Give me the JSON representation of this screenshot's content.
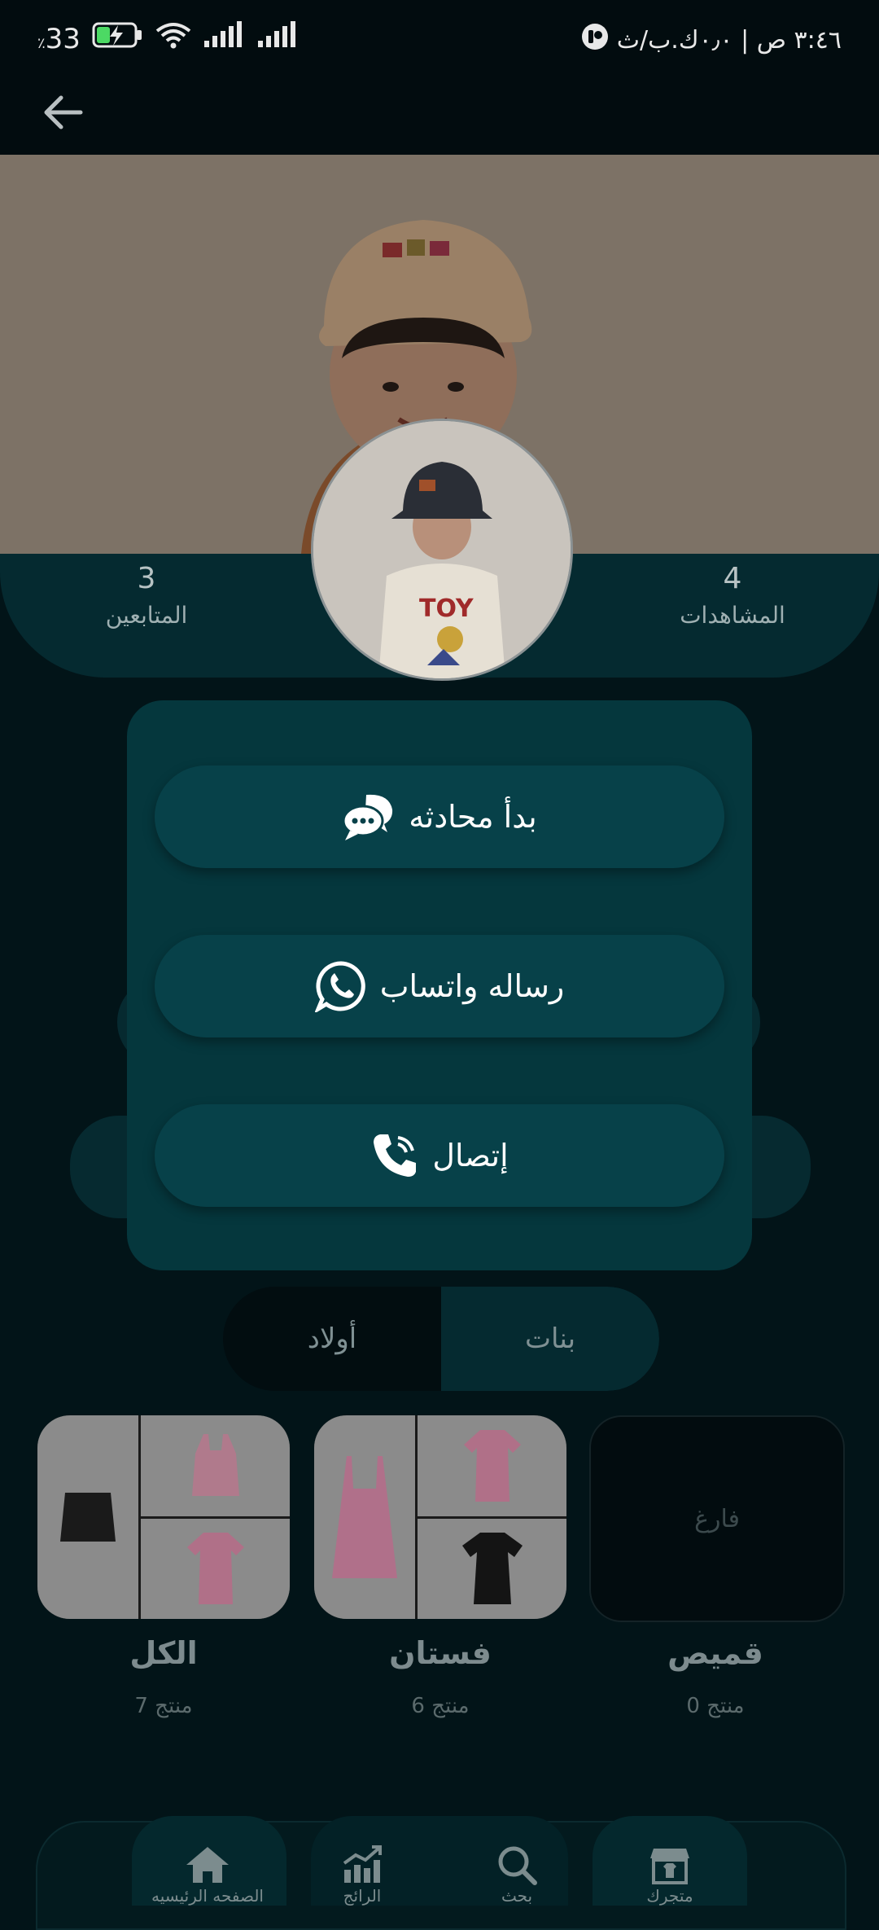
{
  "status_bar": {
    "time": "٣:٤٦ ص | ٠٫٠ك.ب/ث",
    "battery": "33",
    "battery_suffix": "٪"
  },
  "profile": {
    "views_count": "4",
    "views_label": "المشاهدات",
    "followers_count": "3",
    "followers_label": "المتابعين"
  },
  "modal": {
    "start_chat_label": "بدأ محادثه",
    "whatsapp_label": "رساله واتساب",
    "call_label": "إتصال"
  },
  "tabs": {
    "girls": "بنات",
    "boys": "أولاد",
    "active": "girls"
  },
  "categories": [
    {
      "title": "قميص",
      "count": "0 منتج",
      "empty_label": "فارغ"
    },
    {
      "title": "فستان",
      "count": "6 منتج"
    },
    {
      "title": "الكل",
      "count": "7 منتج"
    }
  ],
  "bottom_nav": [
    {
      "label": "متجرك",
      "icon": "store-icon"
    },
    {
      "label": "بحث",
      "icon": "search-icon"
    },
    {
      "label": "الرائج",
      "icon": "trending-chart-icon"
    },
    {
      "label": "الصفحه الرئيسيه",
      "icon": "home-icon"
    }
  ],
  "colors": {
    "background": "#021418",
    "modal": "#05373d",
    "button": "#074149"
  }
}
